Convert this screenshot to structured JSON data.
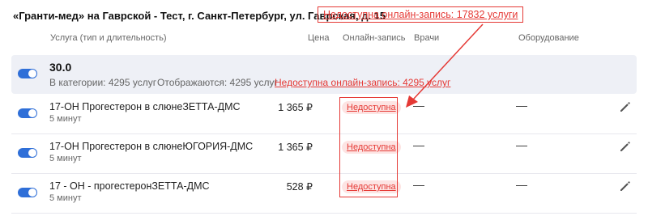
{
  "header": {
    "clinic_title": "«Гранти-мед» на Гаврской - Тест, г. Санкт-Петербург, ул. Гаврская, д. 15",
    "unavailable_link": "Недоступна онлайн-запись: 17832 услуги"
  },
  "columns": {
    "service": "Услуга (тип и длительность)",
    "price": "Цена",
    "online": "Онлайн-запись",
    "doctors": "Врачи",
    "equipment": "Оборудование"
  },
  "category": {
    "name": "30.0",
    "in_category": "В категории: 4295 услуг",
    "displayed": "Отображаются: 4295 услуг",
    "unavailable": "Недоступна онлайн-запись: 4295 услуг"
  },
  "services": [
    {
      "name": "17-ОН Прогестерон в слюнеЗЕТТА-ДМС",
      "duration": "5 минут",
      "price": "1 365 ₽",
      "online": "Недоступна",
      "doctors": "—",
      "equipment": "—"
    },
    {
      "name": "17-ОН Прогестерон в слюнеЮГОРИЯ-ДМС",
      "duration": "5 минут",
      "price": "1 365 ₽",
      "online": "Недоступна",
      "doctors": "—",
      "equipment": "—"
    },
    {
      "name": "17 - ОН - прогестеронЗЕТТА-ДМС",
      "duration": "5 минут",
      "price": "528 ₽",
      "online": "Недоступна",
      "doctors": "—",
      "equipment": "—"
    }
  ],
  "icons": {
    "toggle": "toggle-switch-on",
    "edit": "pencil-icon"
  },
  "colors": {
    "accent": "#2f6fd8",
    "danger": "#e53935",
    "category_bg": "#eef0f6",
    "pill_bg": "#fde4e3"
  }
}
